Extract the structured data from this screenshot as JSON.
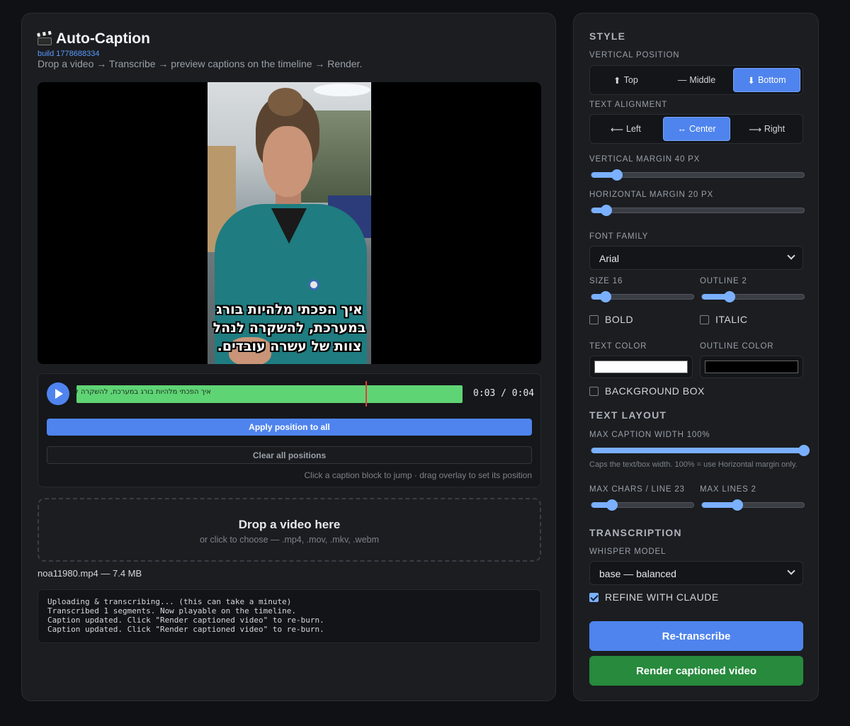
{
  "app": {
    "title": "Auto-Caption",
    "build": "build 1778688334",
    "subtitle": "Drop a video → Transcribe → preview captions on the timeline → Render."
  },
  "video": {
    "caption_lines": [
      "איך הפכתי מלהיות בורג",
      "במערכת, להשקרה לנהל",
      "צוות של עשרה עובדים."
    ]
  },
  "timeline": {
    "segment_label": "איך הפכתי מלהיות בורג במערכת, להשקרה לנ",
    "timecode": "0:03 / 0:04",
    "playhead_fraction": 0.75,
    "apply_label": "Apply position to all",
    "clear_label": "Clear all positions",
    "hint": "Click a caption block to jump · drag overlay to set its position"
  },
  "dropzone": {
    "title": "Drop a video here",
    "subtitle": "or click to choose — .mp4, .mov, .mkv, .webm"
  },
  "file_info": "noa11980.mp4 — 7.4 MB",
  "log": [
    "Uploading & transcribing... (this can take a minute)",
    "Transcribed 1 segments. Now playable on the timeline.",
    "Caption updated. Click \"Render captioned video\" to re-burn.",
    "Caption updated. Click \"Render captioned video\" to re-burn."
  ],
  "style": {
    "heading": "STYLE",
    "vertical_position": {
      "label": "VERTICAL POSITION",
      "options": [
        "Top",
        "Middle",
        "Bottom"
      ],
      "selected": "Bottom"
    },
    "text_alignment": {
      "label": "TEXT ALIGNMENT",
      "options": [
        "Left",
        "Center",
        "Right"
      ],
      "selected": "Center"
    },
    "vertical_margin": {
      "label": "VERTICAL MARGIN 40 PX",
      "value": 40,
      "fraction": 0.12
    },
    "horizontal_margin": {
      "label": "HORIZONTAL MARGIN 20 PX",
      "value": 20,
      "fraction": 0.07
    },
    "font_family": {
      "label": "FONT FAMILY",
      "value": "Arial"
    },
    "size": {
      "label": "SIZE 16",
      "value": 16,
      "fraction": 0.14
    },
    "outline": {
      "label": "OUTLINE 2",
      "value": 2,
      "fraction": 0.27
    },
    "bold": {
      "label": "BOLD",
      "checked": false
    },
    "italic": {
      "label": "ITALIC",
      "checked": false
    },
    "text_color": {
      "label": "TEXT COLOR",
      "value": "#ffffff"
    },
    "outline_color": {
      "label": "OUTLINE COLOR",
      "value": "#000000"
    },
    "background_box": {
      "label": "BACKGROUND BOX",
      "checked": false
    }
  },
  "text_layout": {
    "heading": "TEXT LAYOUT",
    "max_caption_width": {
      "label": "MAX CAPTION WIDTH 100%",
      "value": 100,
      "fraction": 1.0
    },
    "help": "Caps the text/box width. 100% = use Horizontal margin only.",
    "max_chars": {
      "label": "MAX CHARS / LINE 23",
      "value": 23,
      "fraction": 0.2
    },
    "max_lines": {
      "label": "MAX LINES 2",
      "value": 2,
      "fraction": 0.35
    }
  },
  "transcription": {
    "heading": "TRANSCRIPTION",
    "model_label": "WHISPER MODEL",
    "model_value": "base — balanced",
    "refine": {
      "label": "REFINE WITH CLAUDE",
      "checked": true
    },
    "retranscribe_label": "Re-transcribe",
    "render_label": "Render captioned video"
  },
  "icons": {
    "up": "⬆",
    "middle": "—",
    "down": "⬇",
    "left": "⟵",
    "center": "↔",
    "right": "⟶"
  },
  "colors": {
    "accent": "#4f84ee",
    "segment": "#5fd475",
    "playhead": "#e0403a",
    "render": "#278a3d"
  }
}
